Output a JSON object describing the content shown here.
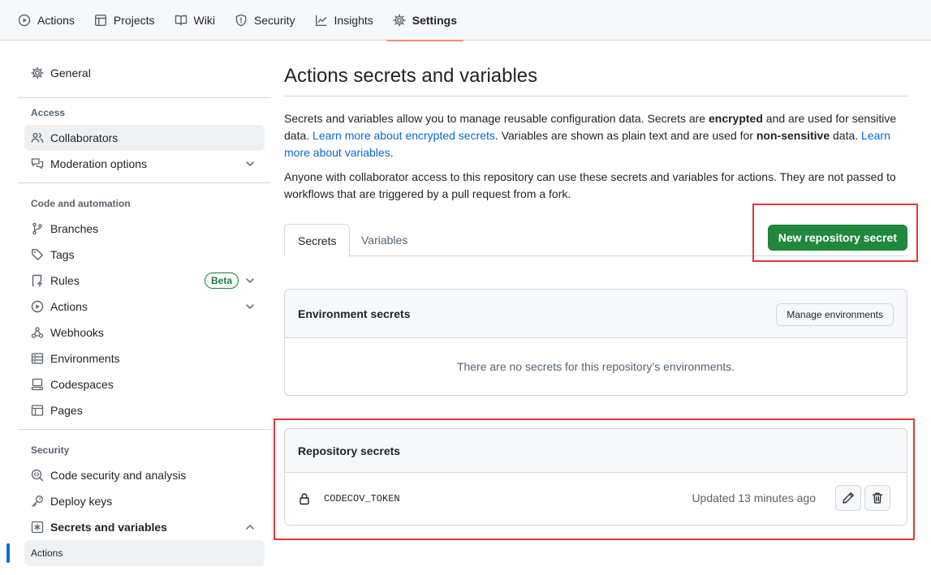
{
  "repo_nav": {
    "tabs": [
      {
        "label": "Actions",
        "icon": "play-icon"
      },
      {
        "label": "Projects",
        "icon": "table-icon"
      },
      {
        "label": "Wiki",
        "icon": "book-icon"
      },
      {
        "label": "Security",
        "icon": "shield-icon"
      },
      {
        "label": "Insights",
        "icon": "graph-icon"
      },
      {
        "label": "Settings",
        "icon": "gear-icon",
        "active": true
      }
    ]
  },
  "sidebar": {
    "general": "General",
    "access_heading": "Access",
    "collaborators": "Collaborators",
    "moderation": "Moderation options",
    "code_heading": "Code and automation",
    "branches": "Branches",
    "tags": "Tags",
    "rules": "Rules",
    "rules_badge": "Beta",
    "actions": "Actions",
    "webhooks": "Webhooks",
    "environments": "Environments",
    "codespaces": "Codespaces",
    "pages": "Pages",
    "security_heading": "Security",
    "code_security": "Code security and analysis",
    "deploy_keys": "Deploy keys",
    "secrets_vars": "Secrets and variables",
    "sub_actions": "Actions"
  },
  "main": {
    "title": "Actions secrets and variables",
    "intro": {
      "p1a": "Secrets and variables allow you to manage reusable configuration data. Secrets are ",
      "p1b": "encrypted",
      "p1c": " and are used for sensitive data. ",
      "link1": "Learn more about encrypted secrets",
      "p1d": ". Variables are shown as plain text and are used for ",
      "p1e": "non-sensitive",
      "p1f": " data. ",
      "link2": "Learn more about variables",
      "p1g": ".",
      "p2": "Anyone with collaborator access to this repository can use these secrets and variables for actions. They are not passed to workflows that are triggered by a pull request from a fork."
    },
    "tabs": [
      "Secrets",
      "Variables"
    ],
    "new_secret_button": "New repository secret",
    "env_secrets": {
      "heading": "Environment secrets",
      "manage_button": "Manage environments",
      "empty": "There are no secrets for this repository’s environments."
    },
    "repo_secrets": {
      "heading": "Repository secrets",
      "items": [
        {
          "name": "CODECOV_TOKEN",
          "updated": "Updated 13 minutes ago"
        }
      ]
    }
  },
  "colors": {
    "primary_button": "#1f883d",
    "link": "#0969da",
    "highlight_box": "#e5383b",
    "beta_badge": "#1a7f37",
    "nav_underline": "#fd8c73"
  }
}
